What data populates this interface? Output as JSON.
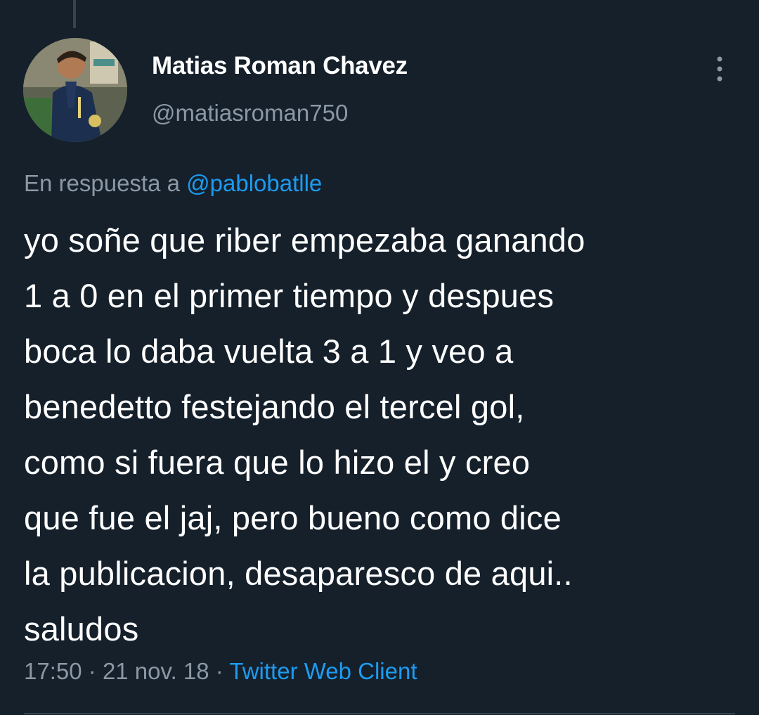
{
  "author": {
    "name": "Matias Roman Chavez",
    "handle": "@matiasroman750"
  },
  "reply": {
    "prefix": "En respuesta a",
    "mention": "@pablobatlle"
  },
  "tweet": {
    "lines": [
      "yo soñe que riber empezaba ganando",
      "1 a 0 en el primer tiempo y despues",
      "boca lo daba vuelta 3 a 1 y veo a",
      "benedetto festejando el tercel gol,",
      "como si fuera que lo hizo el y creo",
      "que fue el jaj, pero bueno como dice",
      "la publicacion, desaparesco de aqui..",
      "saludos"
    ]
  },
  "meta": {
    "time": "17:50",
    "separator": "·",
    "date": "21 nov. 18",
    "source": "Twitter Web Client"
  },
  "icons": {
    "more": "more-vertical-icon",
    "avatar": "profile-photo"
  },
  "colors": {
    "background": "#15202b",
    "primary_text": "#ffffff",
    "secondary_text": "#8b98a5",
    "accent": "#1d9bf0",
    "divider": "#38444d"
  }
}
